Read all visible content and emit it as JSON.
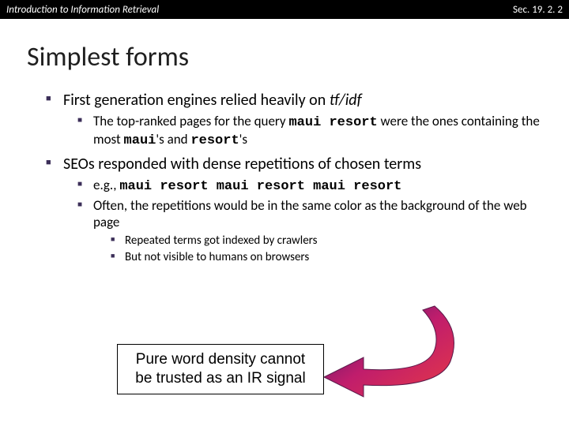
{
  "header": {
    "left": "Introduction to Information Retrieval",
    "right": "Sec. 19. 2. 2"
  },
  "title": "Simplest forms",
  "bullets": {
    "b1_pre": "First generation engines relied heavily on ",
    "b1_ital": "tf/idf",
    "b1a_pre": "The top-ranked pages for the query ",
    "b1a_code1": "maui resort",
    "b1a_mid": " were the ones containing the most ",
    "b1a_code2": "maui",
    "b1a_mid2": "'s and ",
    "b1a_code3": "resort",
    "b1a_post": "'s",
    "b2": "SEOs responded with dense repetitions of chosen terms",
    "b2a_pre": "e.g., ",
    "b2a_code": "maui resort maui resort maui resort",
    "b2b": "Often, the repetitions would be in the same color as the background of the web page",
    "b2b1": "Repeated terms got indexed by crawlers",
    "b2b2": "But not visible to humans on browsers"
  },
  "callout": "Pure word density cannot be trusted as an IR signal"
}
